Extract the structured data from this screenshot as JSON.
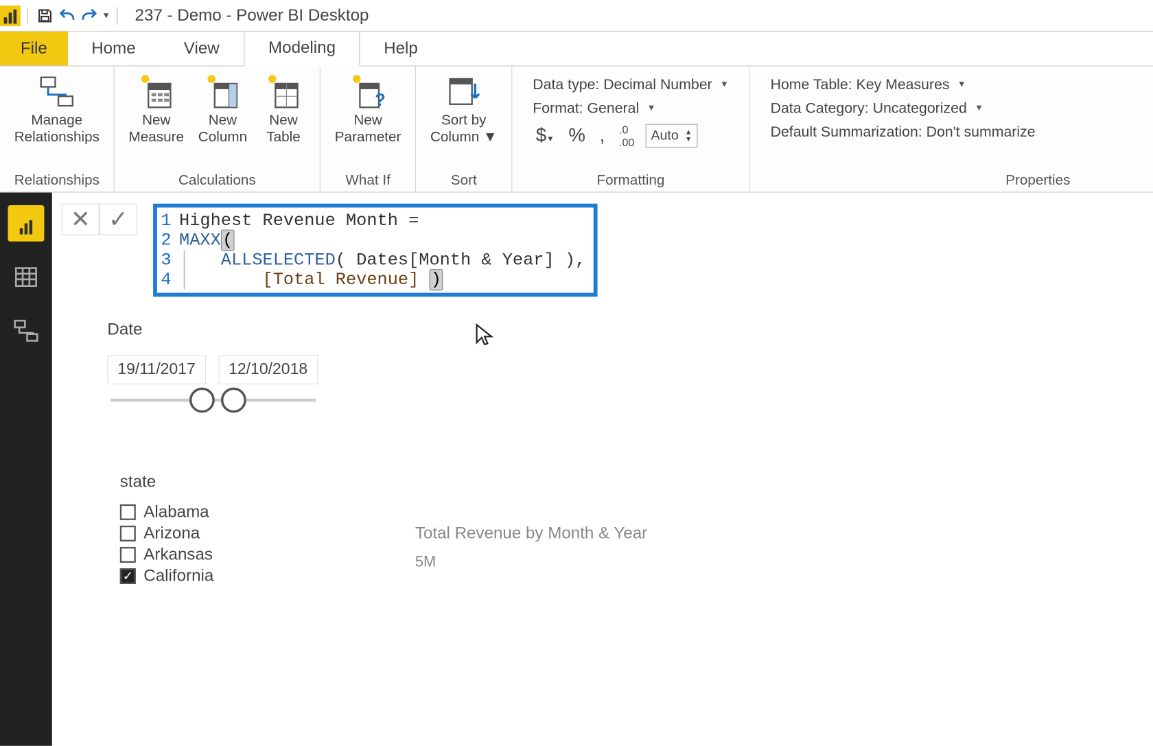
{
  "window": {
    "title": "237 - Demo - Power BI Desktop"
  },
  "tabs": {
    "file": "File",
    "home": "Home",
    "view": "View",
    "modeling": "Modeling",
    "help": "Help",
    "active": "Modeling"
  },
  "ribbon": {
    "relationships": {
      "manage": "Manage\nRelationships",
      "caption": "Relationships"
    },
    "calculations": {
      "newMeasure": "New\nMeasure",
      "newColumn": "New\nColumn",
      "newTable": "New\nTable",
      "caption": "Calculations"
    },
    "whatif": {
      "newParameter": "New\nParameter",
      "caption": "What If"
    },
    "sort": {
      "sortBy": "Sort by\nColumn",
      "caption": "Sort"
    },
    "formatting": {
      "dataType": "Data type: Decimal Number",
      "format": "Format: General",
      "decimalsLabel": "Auto",
      "caption": "Formatting"
    },
    "properties": {
      "homeTable": "Home Table: Key Measures",
      "dataCategory": "Data Category: Uncategorized",
      "defaultSumm": "Default Summarization: Don't summarize",
      "caption": "Properties"
    }
  },
  "formula": {
    "lines": [
      {
        "n": "1",
        "plainPrefix": "Highest Revenue Month ="
      },
      {
        "n": "2",
        "keyword": "MAXX",
        "openParen": "("
      },
      {
        "n": "3",
        "indent": "    ",
        "keyword2": "ALLSELECTED",
        "rest": "( Dates[Month & Year] ),"
      },
      {
        "n": "4",
        "indent": "        ",
        "measure": "[Total Revenue]",
        "closeParen": " )"
      }
    ]
  },
  "dateSlicer": {
    "label": "Date",
    "start": "19/11/2017",
    "end": "12/10/2018"
  },
  "stateSlicer": {
    "label": "state",
    "items": [
      {
        "name": "Alabama",
        "checked": false
      },
      {
        "name": "Arizona",
        "checked": false
      },
      {
        "name": "Arkansas",
        "checked": false
      },
      {
        "name": "California",
        "checked": true
      }
    ]
  },
  "chart": {
    "title": "Total Revenue by Month & Year",
    "tick": "5M"
  }
}
